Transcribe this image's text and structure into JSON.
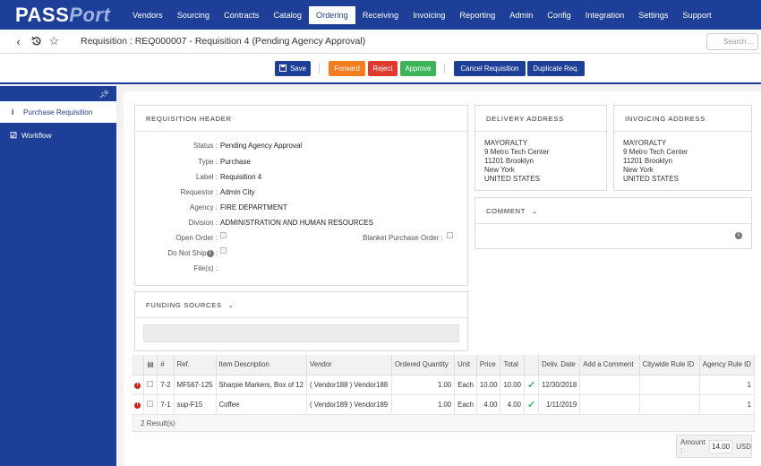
{
  "brand": {
    "name_a": "PASS",
    "name_b": "Port"
  },
  "nav": [
    "Vendors",
    "Sourcing",
    "Contracts",
    "Catalog",
    "Ordering",
    "Receiving",
    "Invoicing",
    "Reporting",
    "Admin",
    "Config",
    "Integration",
    "Settings",
    "Support"
  ],
  "nav_active": "Ordering",
  "title": "Requisition : REQ000007 - Requisition 4 (Pending Agency Approval)",
  "search_placeholder": "Search ...",
  "actions": {
    "save": "Save",
    "forward": "Forward",
    "reject": "Reject",
    "approve": "Approve",
    "cancel": "Cancel Requisition",
    "duplicate": "Duplicate Req."
  },
  "sidebar": {
    "items": [
      {
        "label": "Purchase Requisition",
        "icon": "info-icon"
      },
      {
        "label": "Workflow",
        "icon": "check-square-icon"
      }
    ]
  },
  "header_panel": {
    "title": "REQUISITION HEADER",
    "status_label": "Status :",
    "status": "Pending Agency Approval",
    "type_label": "Type :",
    "type": "Purchase",
    "label_label": "Label :",
    "label": "Requisition 4",
    "requestor_label": "Requestor :",
    "requestor": "Admin City",
    "agency_label": "Agency :",
    "agency": "FIRE DEPARTMENT",
    "division_label": "Division :",
    "division": "ADMINISTRATION AND HUMAN RESOURCES",
    "open_order_label": "Open Order :",
    "blanket_label": "Blanket Purchase Order :",
    "do_not_ship_label": "Do Not Ship",
    "files_label": "File(s) :"
  },
  "delivery": {
    "title": "DELIVERY ADDRESS",
    "lines": [
      "MAYORALTY",
      "9 Metro Tech Center",
      "11201 Brooklyn",
      "New York",
      "UNITED STATES"
    ]
  },
  "invoicing": {
    "title": "INVOICING ADDRESS",
    "lines": [
      "MAYORALTY",
      "9 Metro Tech Center",
      "11201 Brooklyn",
      "New York",
      "UNITED STATES"
    ]
  },
  "comment": {
    "title": "COMMENT"
  },
  "funding": {
    "title": "FUNDING SOURCES"
  },
  "table": {
    "headers": [
      "#",
      "Ref.",
      "Item Description",
      "Vendor",
      "Ordered Quantity",
      "Unit",
      "Price",
      "Total",
      "",
      "Deliv. Date",
      "Add a Comment",
      "Citywide Rule ID",
      "Agency Rule ID"
    ],
    "rows": [
      {
        "num": "7-2",
        "ref": "MF567-125",
        "desc": "Sharpie Markers, Box of 12",
        "vendor": "( Vendor188 ) Vendor188",
        "qty": "1.00",
        "unit": "Each",
        "price": "10.00",
        "total": "10.00",
        "date": "12/30/2018",
        "comment": "",
        "citywide": "",
        "agency": "1"
      },
      {
        "num": "7-1",
        "ref": "sup-F15",
        "desc": "Coffee",
        "vendor": "( Vendor189 ) Vendor189",
        "qty": "1.00",
        "unit": "Each",
        "price": "4.00",
        "total": "4.00",
        "date": "1/11/2019",
        "comment": "",
        "citywide": "",
        "agency": "1"
      }
    ],
    "results": "2 Result(s)"
  },
  "amount": {
    "label": "Amount :",
    "value": "14.00",
    "currency": "USD"
  }
}
